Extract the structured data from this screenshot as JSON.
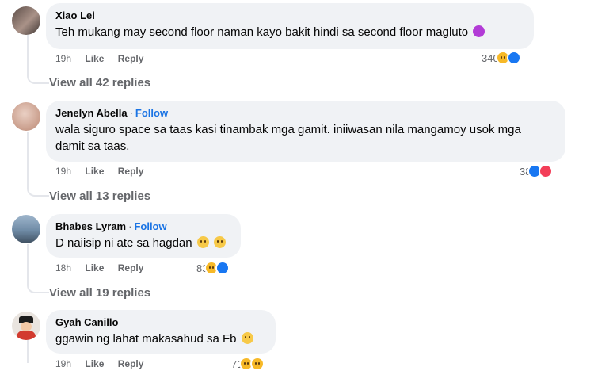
{
  "comments": [
    {
      "author": "Xiao Lei",
      "follow": "",
      "text": "Teh mukang may second floor naman kayo bakit hindi sa second floor magluto",
      "time": "19h",
      "like": "Like",
      "reply": "Reply",
      "reaction_count": "340",
      "reactions": [
        "haha",
        "like"
      ],
      "view_replies": "View all 42 replies",
      "avatar_color": "#8a7a74"
    },
    {
      "author": "Jenelyn Abella",
      "separator": "·",
      "follow": "Follow",
      "text_line1": "wala siguro space sa taas kasi tinambak mga gamit. iniiwasan nila mangamoy usok mga",
      "text_line2": "damit sa taas.",
      "time": "19h",
      "like": "Like",
      "reply": "Reply",
      "reaction_count": "38",
      "reactions": [
        "like",
        "love"
      ],
      "view_replies": "View all 13 replies",
      "avatar_color": "#d8b7a8"
    },
    {
      "author": "Bhabes Lyram",
      "separator": "·",
      "follow": "Follow",
      "text": "D naiisip ni ate sa hagdan",
      "time": "18h",
      "like": "Like",
      "reply": "Reply",
      "reaction_count": "83",
      "reactions": [
        "haha",
        "like"
      ],
      "view_replies": "View all 19 replies",
      "avatar_color": "#6f8ba6"
    },
    {
      "author": "Gyah Canillo",
      "follow": "",
      "text": "ggawin ng lahat makasahud sa Fb",
      "time": "19h",
      "like": "Like",
      "reply": "Reply",
      "reaction_count": "71",
      "avatar_color": "#d23b2f"
    }
  ],
  "colors": {
    "bubble": "#f0f2f5",
    "secondary_text": "#65676b",
    "follow_blue": "#1b74e4",
    "like_blue": "#1877f2",
    "love_red": "#f33e58",
    "haha_yellow": "#f7b928"
  }
}
